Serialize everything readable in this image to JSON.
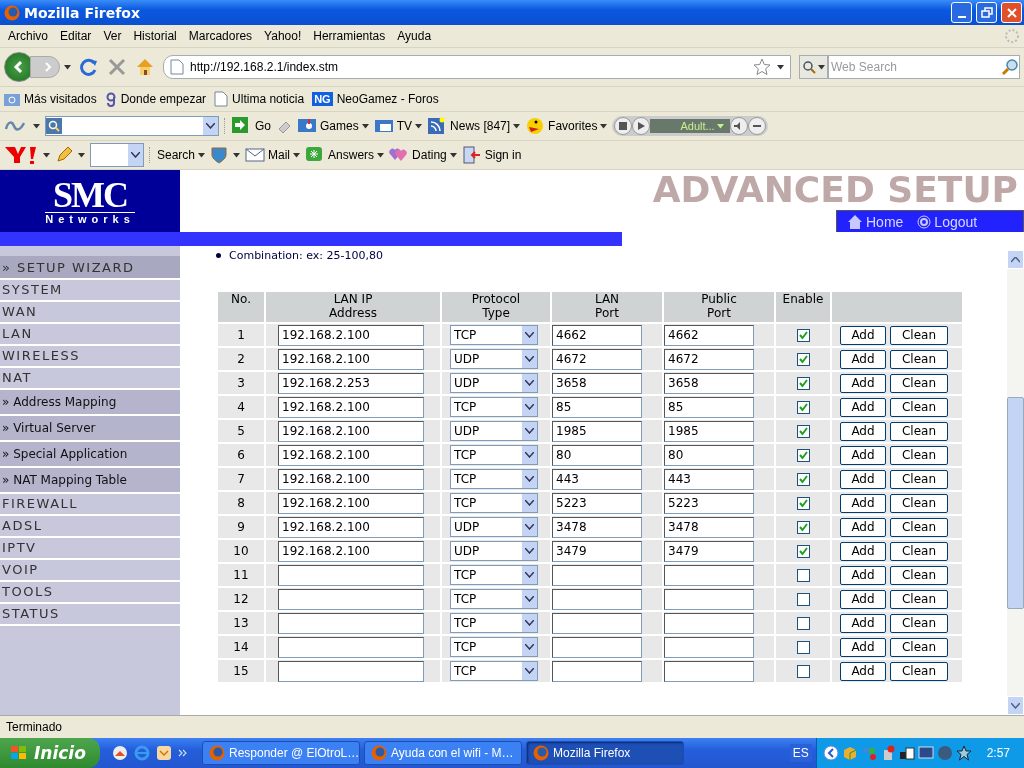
{
  "window": {
    "title": "Mozilla Firefox"
  },
  "menu": [
    "Archivo",
    "Editar",
    "Ver",
    "Historial",
    "Marcadores",
    "Yahoo!",
    "Herramientas",
    "Ayuda"
  ],
  "address_bar": {
    "url": "http://192.168.2.1/index.stm"
  },
  "search_field": {
    "placeholder": "Web Search"
  },
  "bookmarks": [
    {
      "kind": "folder",
      "label": "Más visitados"
    },
    {
      "kind": "g",
      "label": "Donde empezar"
    },
    {
      "kind": "page",
      "label": "Ultima noticia"
    },
    {
      "kind": "ng",
      "label": "NeoGamez - Foros",
      "badge": "NG"
    }
  ],
  "toolbar_1": {
    "items": [
      {
        "kind": "go",
        "label": "Go"
      },
      {
        "kind": "games",
        "label": "Games"
      },
      {
        "kind": "tv",
        "label": "TV"
      },
      {
        "kind": "news",
        "label": "News [847]"
      },
      {
        "kind": "smiley",
        "label": "Favorites"
      }
    ],
    "player_label": "Adult..."
  },
  "toolbar_2": {
    "items": [
      {
        "kind": "search",
        "label": "Search"
      },
      {
        "kind": "mail",
        "label": "Mail"
      },
      {
        "kind": "answers",
        "label": "Answers"
      },
      {
        "kind": "dating",
        "label": "Dating"
      },
      {
        "kind": "signin",
        "label": "Sign in"
      }
    ]
  },
  "page": {
    "logo": {
      "brand": "SMC",
      "tagline": "Networks"
    },
    "banner": "ADVANCED SETUP",
    "header_links": [
      {
        "kind": "home",
        "label": "Home"
      },
      {
        "kind": "logout",
        "label": "Logout"
      }
    ],
    "hint": "Combination: ex: 25-100,80",
    "sidebar": [
      {
        "kind": "wizard",
        "label": "» SETUP WIZARD"
      },
      {
        "kind": "main",
        "label": "SYSTEM"
      },
      {
        "kind": "main",
        "label": "WAN"
      },
      {
        "kind": "main",
        "label": "LAN"
      },
      {
        "kind": "main",
        "label": "WIRELESS"
      },
      {
        "kind": "main",
        "label": "NAT"
      },
      {
        "kind": "sub",
        "label": "» Address Mapping"
      },
      {
        "kind": "sub",
        "label": "» Virtual Server"
      },
      {
        "kind": "sub",
        "label": "» Special Application"
      },
      {
        "kind": "sub",
        "label": "» NAT Mapping Table"
      },
      {
        "kind": "main",
        "label": "FIREWALL"
      },
      {
        "kind": "main",
        "label": "ADSL"
      },
      {
        "kind": "main",
        "label": "IPTV"
      },
      {
        "kind": "main",
        "label": "VOIP"
      },
      {
        "kind": "main",
        "label": "TOOLS"
      },
      {
        "kind": "main",
        "label": "STATUS"
      }
    ],
    "table": {
      "columns": [
        "No.",
        "LAN IP Address",
        "Protocol Type",
        "LAN Port",
        "Public Port",
        "Enable"
      ],
      "rows": [
        {
          "no": "1",
          "ip": "192.168.2.100",
          "protocol": "TCP",
          "lan_port": "4662",
          "public_port": "4662",
          "checked": true,
          "buttons": [
            "Add",
            "Clean"
          ]
        },
        {
          "no": "2",
          "ip": "192.168.2.100",
          "protocol": "UDP",
          "lan_port": "4672",
          "public_port": "4672",
          "checked": true,
          "buttons": [
            "Add",
            "Clean"
          ]
        },
        {
          "no": "3",
          "ip": "192.168.2.253",
          "protocol": "UDP",
          "lan_port": "3658",
          "public_port": "3658",
          "checked": true,
          "buttons": [
            "Add",
            "Clean"
          ]
        },
        {
          "no": "4",
          "ip": "192.168.2.100",
          "protocol": "TCP",
          "lan_port": "85",
          "public_port": "85",
          "checked": true,
          "buttons": [
            "Add",
            "Clean"
          ]
        },
        {
          "no": "5",
          "ip": "192.168.2.100",
          "protocol": "UDP",
          "lan_port": "1985",
          "public_port": "1985",
          "checked": true,
          "buttons": [
            "Add",
            "Clean"
          ]
        },
        {
          "no": "6",
          "ip": "192.168.2.100",
          "protocol": "TCP",
          "lan_port": "80",
          "public_port": "80",
          "checked": true,
          "buttons": [
            "Add",
            "Clean"
          ]
        },
        {
          "no": "7",
          "ip": "192.168.2.100",
          "protocol": "TCP",
          "lan_port": "443",
          "public_port": "443",
          "checked": true,
          "buttons": [
            "Add",
            "Clean"
          ]
        },
        {
          "no": "8",
          "ip": "192.168.2.100",
          "protocol": "TCP",
          "lan_port": "5223",
          "public_port": "5223",
          "checked": true,
          "buttons": [
            "Add",
            "Clean"
          ]
        },
        {
          "no": "9",
          "ip": "192.168.2.100",
          "protocol": "UDP",
          "lan_port": "3478",
          "public_port": "3478",
          "checked": true,
          "buttons": [
            "Add",
            "Clean"
          ]
        },
        {
          "no": "10",
          "ip": "192.168.2.100",
          "protocol": "UDP",
          "lan_port": "3479",
          "public_port": "3479",
          "checked": true,
          "buttons": [
            "Add",
            "Clean"
          ]
        },
        {
          "no": "11",
          "protocol": "TCP",
          "checked": false,
          "buttons": [
            "Add",
            "Clean"
          ]
        },
        {
          "no": "12",
          "protocol": "TCP",
          "checked": false,
          "buttons": [
            "Add",
            "Clean"
          ]
        },
        {
          "no": "13",
          "protocol": "TCP",
          "checked": false,
          "buttons": [
            "Add",
            "Clean"
          ]
        },
        {
          "no": "14",
          "protocol": "TCP",
          "checked": false,
          "buttons": [
            "Add",
            "Clean"
          ]
        },
        {
          "no": "15",
          "protocol": "TCP",
          "checked": false,
          "buttons": [
            "Add",
            "Clean"
          ]
        }
      ]
    }
  },
  "status_bar": "Terminado",
  "taskbar": {
    "start": "Inicio",
    "tasks": [
      {
        "label": "Responder @ ElOtroL…",
        "selected": false
      },
      {
        "label": "Ayuda con el wifi - M…",
        "selected": false
      },
      {
        "label": "Mozilla Firefox",
        "selected": true
      }
    ],
    "language": "ES",
    "clock": "2:57"
  }
}
